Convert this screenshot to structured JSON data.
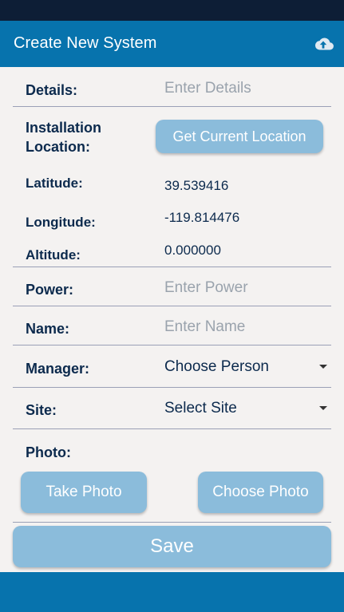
{
  "header": {
    "title": "Create New System",
    "upload_icon": "cloud-upload-icon"
  },
  "form": {
    "details": {
      "label": "Details:",
      "placeholder": "Enter Details"
    },
    "installation": {
      "label_line1": "Installation",
      "label_line2": "Location:",
      "button": "Get Current Location"
    },
    "latitude": {
      "label": "Latitude:",
      "value": "39.539416"
    },
    "longitude": {
      "label": "Longitude:",
      "value": "-119.814476"
    },
    "altitude": {
      "label": "Altitude:",
      "value": "0.000000"
    },
    "power": {
      "label": "Power:",
      "placeholder": "Enter Power"
    },
    "name": {
      "label": "Name:",
      "placeholder": "Enter Name"
    },
    "manager": {
      "label": "Manager:",
      "selected": "Choose Person"
    },
    "site": {
      "label": "Site:",
      "selected": "Select Site"
    },
    "photo": {
      "label": "Photo:",
      "take_button": "Take Photo",
      "choose_button": "Choose Photo"
    },
    "save_button": "Save"
  },
  "colors": {
    "primary": "#0773ad",
    "status_bar": "#0d1e36",
    "button": "#8bbcdb",
    "label": "#0c2a4d",
    "background": "#f4f2f1"
  }
}
